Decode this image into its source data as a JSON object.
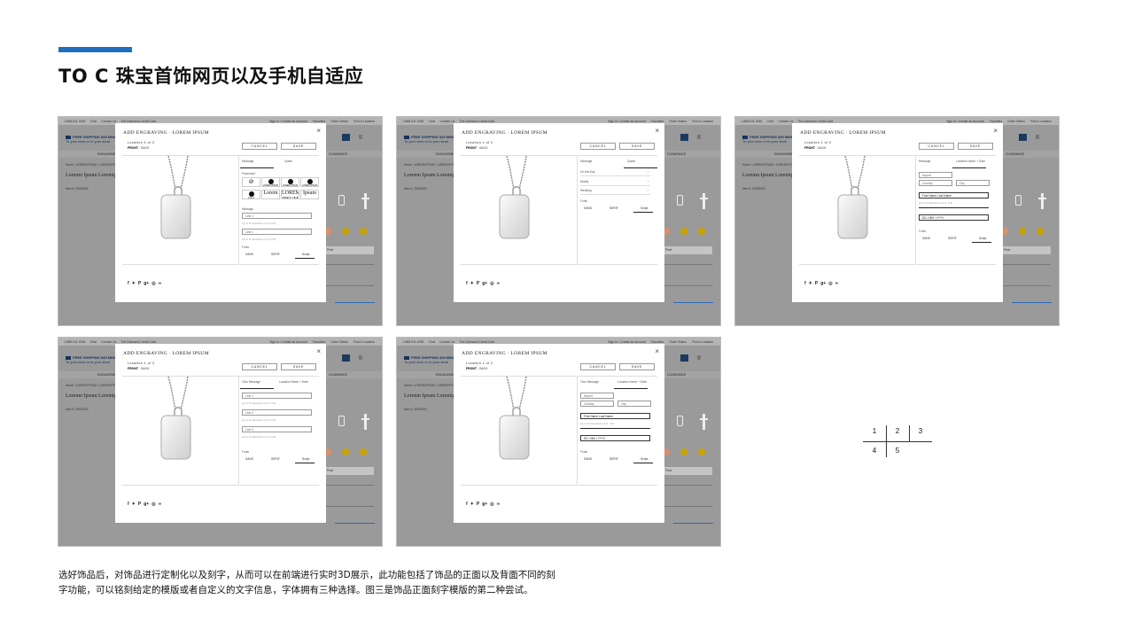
{
  "page": {
    "title": "TO C 珠宝首饰网页以及手机自适应",
    "description_line1": "选好饰品后，对饰品进行定制化以及刻字，从而可以在前端进行实时3D展示，此功能包括了饰品的正面以及背面不同的刻",
    "description_line2": "字功能，可以铭刻给定的模版或者自定义的文字信息，字体拥有三种选择。图三是饰品正面刻字模版的第二种尝试。",
    "accent_color": "#1d6fc0"
  },
  "site": {
    "top_phone": "1-888-511-0081",
    "top_chat": "Chat",
    "top_contact": "Contact Us",
    "top_card": "The Diamond Credit Card",
    "top_sign": "Sign In / Create an Account",
    "top_fav": "Favorites",
    "top_order": "Order Status",
    "top_find": "Find A Location",
    "ship_bold": "FREE SHIPPING $49 MINIMUM",
    "ship_sub": "To your door or to your store",
    "nav_left": "ENGAGEMENT",
    "nav_right": "CLEARANCE",
    "crumb": "Home  ›  LOREM IPSUM  ›  LOREM IPSUM",
    "product": "Loremn Ipsum Loremip",
    "item": "Item #: 20190002",
    "row_label": "Find"
  },
  "modal": {
    "title": "ADD ENGRAVING · LOREM IPSUM",
    "close": "×",
    "location": "Location 1 of 2",
    "front": "FRONT",
    "back": "BACK",
    "cancel": "CANCEL",
    "save": "SAVE",
    "share_icons": [
      "facebook-icon",
      "twitter-icon",
      "pinterest-icon",
      "google-plus-icon",
      "weibo-icon",
      "link-icon"
    ],
    "share_glyphs": "f 🐦 P g+ ◎ ∞"
  },
  "panels": {
    "s1": {
      "tab1": "Message",
      "tab2": "Quote",
      "placement": "Placement",
      "plates": [
        "LOREM IPSUM",
        "LOREM IPSUM",
        "LOREM IPSUM",
        "LOREM IPSUM",
        "Lorem",
        "Lorem",
        "LOREM IPSUM",
        "Ipsum"
      ],
      "message": "Message",
      "line1": "Line 1",
      "line2": "Line 2",
      "hint": "Up to 8 characters (A-Z, 0-9)",
      "fonts_label": "Fonts",
      "font1": "SANS",
      "font2": "SERIF",
      "font3": "Script"
    },
    "s2": {
      "tab1": "Message",
      "tab2": "Quote",
      "occ1": "On this Day",
      "occ2": "Mostly",
      "occ3": "Wedding",
      "fonts_label": "Fonts",
      "font1": "SANS",
      "font2": "SERIF",
      "font3": "Script"
    },
    "s3": {
      "tab1": "Message",
      "tab2": "Location Name + Date",
      "f1": "Airport",
      "f2": "Country",
      "f3": "City",
      "f4": "First Name Last Name",
      "hint": "Up to 8 characters (A-Z, 0-9)",
      "f5": "DD / MM / YYYY",
      "fonts_label": "Fonts",
      "font1": "SANS",
      "font2": "SERIF",
      "font3": "Script"
    },
    "s4": {
      "tab1": "Own Message",
      "tab2": "Location Name + Date",
      "line1": "Line 1",
      "line2": "Line 2",
      "line3": "Line 3",
      "hint": "Up to 8 characters (A-Z, 0-9)",
      "fonts_label": "Fonts",
      "font1": "SANS",
      "font2": "SERIF",
      "font3": "Script"
    },
    "s5": {
      "tab1": "Own Message",
      "tab2": "Location Name + Date",
      "f1": "Airport",
      "f2": "Country",
      "f3": "City",
      "f4": "First Name Last Name",
      "hint": "Up to 8 characters (A-Z, 0-9)",
      "f5": "DD / MM / YYYY",
      "fonts_label": "Fonts",
      "font1": "SANS",
      "font2": "SERIF",
      "font3": "Script"
    }
  },
  "grid_key": [
    "1",
    "2",
    "3",
    "4",
    "5"
  ]
}
